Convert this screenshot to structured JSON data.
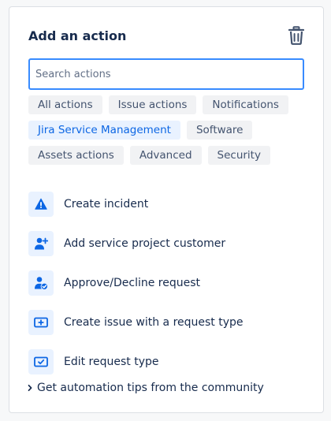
{
  "panel": {
    "title": "Add an action",
    "delete_icon": "trash-icon"
  },
  "search": {
    "placeholder": "Search actions",
    "value": ""
  },
  "filters": [
    {
      "label": "All actions",
      "selected": false
    },
    {
      "label": "Issue actions",
      "selected": false
    },
    {
      "label": "Notifications",
      "selected": false
    },
    {
      "label": "Jira Service Management",
      "selected": true
    },
    {
      "label": "Software",
      "selected": false
    },
    {
      "label": "Assets actions",
      "selected": false
    },
    {
      "label": "Advanced",
      "selected": false
    },
    {
      "label": "Security",
      "selected": false
    }
  ],
  "actions": [
    {
      "label": "Create incident",
      "icon": "warning-icon"
    },
    {
      "label": "Add service project customer",
      "icon": "add-user-icon"
    },
    {
      "label": "Approve/Decline request",
      "icon": "user-check-icon"
    },
    {
      "label": "Create issue with a request type",
      "icon": "add-request-icon"
    },
    {
      "label": "Edit request type",
      "icon": "edit-request-icon"
    }
  ],
  "tips": {
    "label": "Get automation tips from the community"
  },
  "colors": {
    "accent": "#0c66e4",
    "icon_bg": "#e9f2ff",
    "chip_bg": "#f1f2f4",
    "focus_border": "#388bff"
  }
}
